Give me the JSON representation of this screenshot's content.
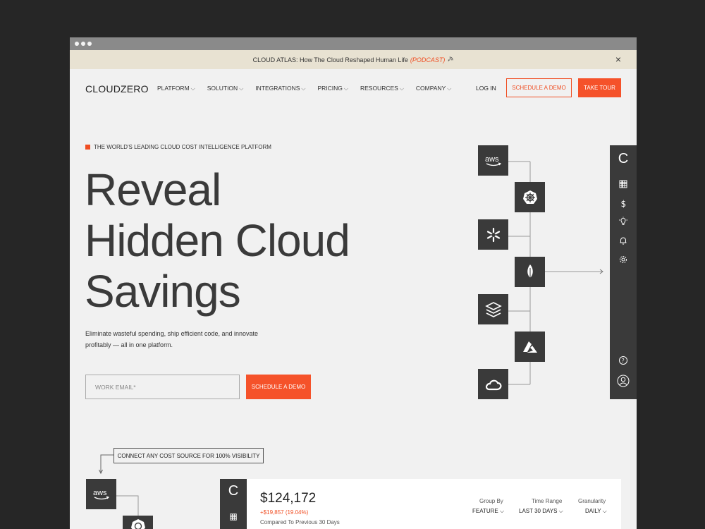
{
  "banner": {
    "text": "CLOUD ATLAS: How The Cloud Reshaped Human Life",
    "podcast": "(PODCAST)",
    "close": "×"
  },
  "nav": {
    "logo": "CLOUDZERO",
    "menu": [
      {
        "label": "PLATFORM"
      },
      {
        "label": "SOLUTION"
      },
      {
        "label": "INTEGRATIONS"
      },
      {
        "label": "PRICING"
      },
      {
        "label": "RESOURCES"
      },
      {
        "label": "COMPANY"
      }
    ],
    "login": "LOG IN",
    "schedule_demo": "SCHEDULE A DEMO",
    "take_tour": "TAKE TOUR"
  },
  "hero": {
    "eyebrow": "THE WORLD'S LEADING CLOUD COST INTELLIGENCE PLATFORM",
    "title_line1": "Reveal",
    "title_line2": "Hidden Cloud",
    "title_line3": "Savings",
    "subtitle": "Eliminate wasteful spending, ship efficient code, and innovate profitably — all in one platform.",
    "email_placeholder": "WORK EMAIL*",
    "cta": "SCHEDULE A DEMO"
  },
  "diagram": {
    "nodes": [
      {
        "icon": "aws-icon",
        "label": "aws"
      },
      {
        "icon": "kubernetes-icon"
      },
      {
        "icon": "snowflake-icon"
      },
      {
        "icon": "mongodb-icon"
      },
      {
        "icon": "databricks-icon"
      },
      {
        "icon": "azure-icon"
      },
      {
        "icon": "google-cloud-icon"
      }
    ],
    "sidebar_brand": "C",
    "sidebar_icons": [
      "grid-icon",
      "dollar-icon",
      "lightbulb-icon",
      "bell-icon",
      "gear-icon",
      "help-icon",
      "user-icon"
    ]
  },
  "lower": {
    "connect_label": "CONNECT ANY COST SOURCE FOR 100% VISIBILITY",
    "aws_label": "aws",
    "card": {
      "brand": "C",
      "amount": "$124,172",
      "delta": "+$19,857 (19.04%)",
      "compare": "Compared To Previous 30 Days",
      "group_by_label": "Group By",
      "group_by_value": "FEATURE",
      "time_range_label": "Time Range",
      "time_range_value": "LAST 30 DAYS",
      "granularity_label": "Granularity",
      "granularity_value": "DAILY"
    }
  },
  "colors": {
    "accent": "#f5522a",
    "dark": "#3a3a3a",
    "banner_bg": "#e8e2d2",
    "page_bg": "#f1f1f1",
    "backdrop": "#262626"
  }
}
